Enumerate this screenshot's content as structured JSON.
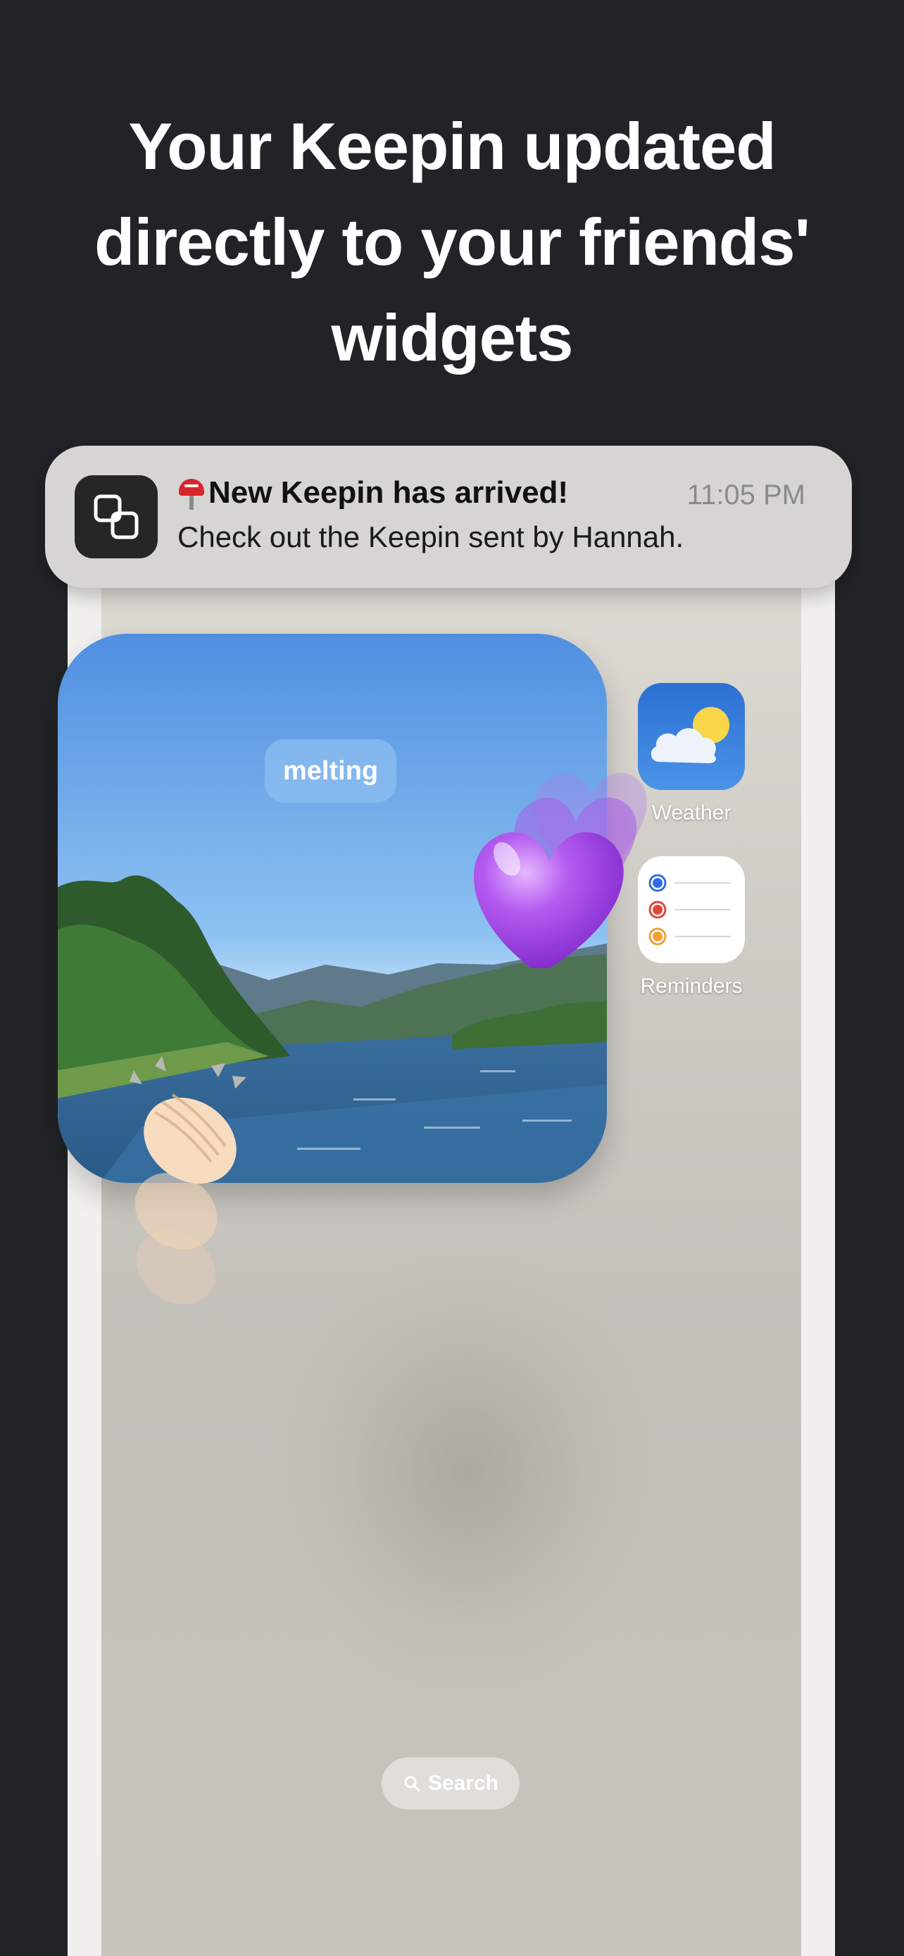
{
  "headline": {
    "line1": "Your Keepin updated",
    "line2": "directly to your friends'",
    "line3": "widgets"
  },
  "notification": {
    "app_icon": "keepin-squares-icon",
    "emoji_icon": "mailbox-icon",
    "title": "New Keepin has arrived!",
    "time": "11:05 PM",
    "body": "Check out the Keepin sent by Hannah."
  },
  "widget": {
    "keyword": "melting",
    "reactions": [
      "purple-heart-icon",
      "clapping-hands-icon"
    ]
  },
  "apps": [
    {
      "label": "Weather",
      "icon": "weather-icon"
    },
    {
      "label": "Reminders",
      "icon": "reminders-icon"
    }
  ],
  "search": {
    "label": "Search",
    "icon": "search-icon"
  },
  "colors": {
    "background": "#222326",
    "heart": "#a24de8",
    "weather_blue": "#2c6fd4"
  }
}
